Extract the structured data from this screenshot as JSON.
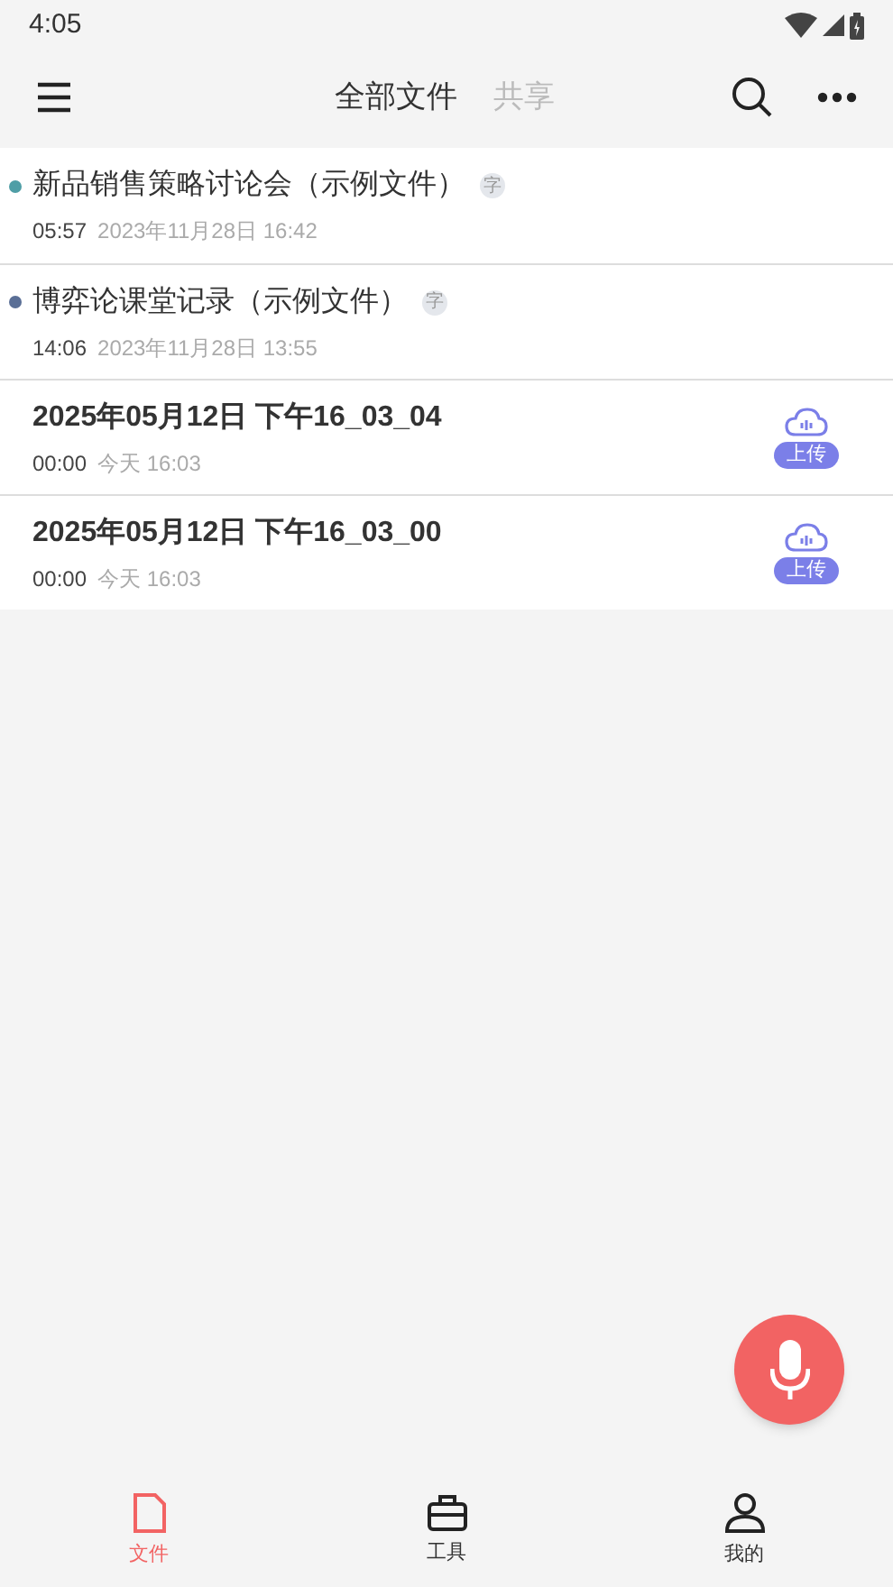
{
  "status_bar": {
    "time": "4:05"
  },
  "header": {
    "tabs": [
      {
        "label": "全部文件",
        "selected": true
      },
      {
        "label": "共享",
        "selected": false
      }
    ]
  },
  "files": [
    {
      "kind": "sample",
      "title": "新品销售策略讨论会（示例文件）",
      "color": "#4f9ea6",
      "badge": "字",
      "duration": "05:57",
      "date": "2023年11月28日 16:42"
    },
    {
      "kind": "sample",
      "title": "博弈论课堂记录（示例文件）",
      "color": "#5a6f96",
      "badge": "字",
      "duration": "14:06",
      "date": "2023年11月28日 13:55"
    },
    {
      "kind": "local",
      "title": "2025年05月12日 下午16_03_04",
      "duration": "00:00",
      "date": "今天 16:03",
      "action": "上传"
    },
    {
      "kind": "local",
      "title": "2025年05月12日 下午16_03_00",
      "duration": "00:00",
      "date": "今天 16:03",
      "action": "上传"
    }
  ],
  "bottom_nav": [
    {
      "label": "文件",
      "selected": true
    },
    {
      "label": "工具",
      "selected": false
    },
    {
      "label": "我的",
      "selected": false
    }
  ]
}
